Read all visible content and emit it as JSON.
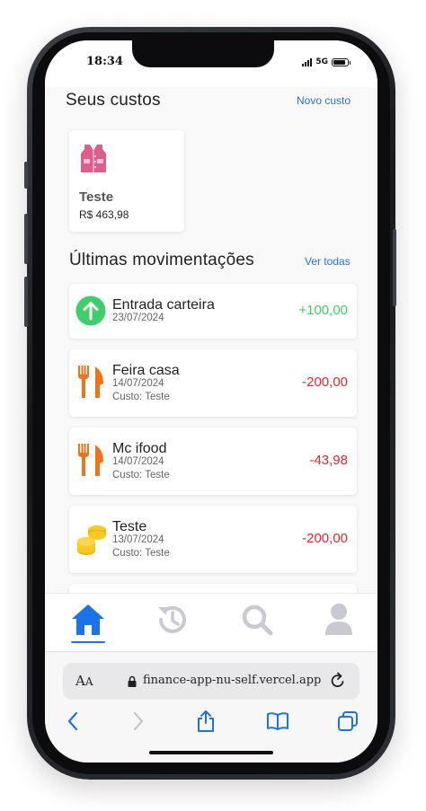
{
  "status_bar": {
    "time": "18:34",
    "network": "5G",
    "battery_level": 0.85
  },
  "costs": {
    "title": "Seus custos",
    "new_cost_label": "Novo custo",
    "items": [
      {
        "icon": "vest-icon",
        "name": "Teste",
        "value": "R$ 463,98"
      }
    ]
  },
  "movements": {
    "title": "Últimas movimentações",
    "see_all_label": "Ver todas",
    "items": [
      {
        "icon": "arrow-up-circle-icon",
        "title": "Entrada carteira",
        "date": "23/07/2024",
        "cost": "",
        "amount": "+100,00",
        "amount_color": "#3ecf6a"
      },
      {
        "icon": "fork-knife-icon",
        "title": "Feira casa",
        "date": "14/07/2024",
        "cost": "Custo: Teste",
        "amount": "-200,00",
        "amount_color": "#e8242c"
      },
      {
        "icon": "fork-knife-icon",
        "title": "Mc ifood",
        "date": "14/07/2024",
        "cost": "Custo: Teste",
        "amount": "-43,98",
        "amount_color": "#e8242c"
      },
      {
        "icon": "coins-icon",
        "title": "Teste",
        "date": "13/07/2024",
        "cost": "Custo: Teste",
        "amount": "-200,00",
        "amount_color": "#e8242c"
      }
    ]
  },
  "tab_bar": {
    "tabs": [
      {
        "name": "home",
        "icon": "home-icon",
        "active": true
      },
      {
        "name": "history",
        "icon": "history-icon",
        "active": false
      },
      {
        "name": "search",
        "icon": "search-icon",
        "active": false
      },
      {
        "name": "profile",
        "icon": "user-icon",
        "active": false
      }
    ],
    "active_color": "#1a73e8",
    "inactive_color": "#c8c9d2"
  },
  "browser": {
    "text_size_label": "AA",
    "url": "finance-app-nu-self.vercel.app",
    "accent_color": "#1a73e8"
  }
}
